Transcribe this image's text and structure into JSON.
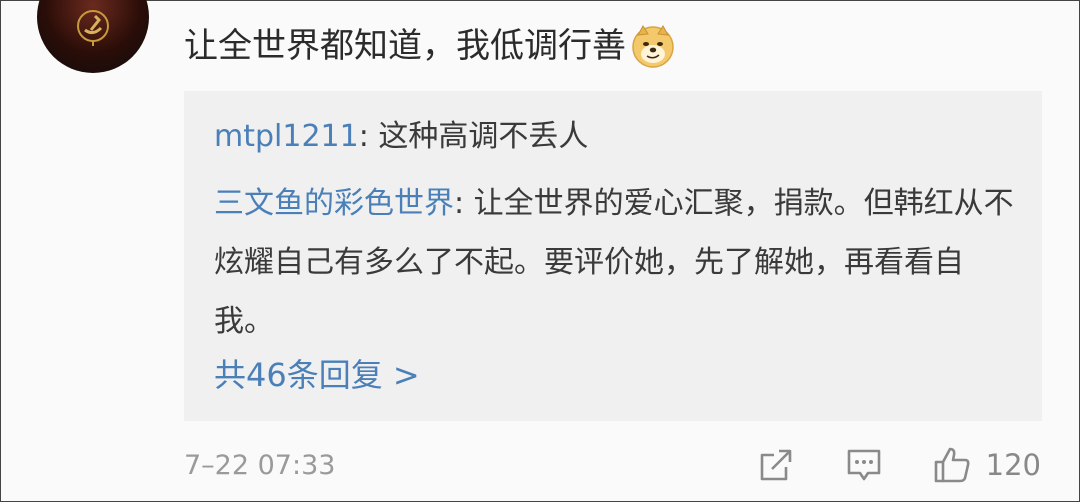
{
  "comment": {
    "avatar_icon": "profile-avatar-emblem-icon",
    "text": "让全世界都知道，我低调行善",
    "emoji_icon": "doge-emoji-icon"
  },
  "replies": [
    {
      "user": "mtpl1211",
      "sep": ": ",
      "text": "这种高调不丢人"
    },
    {
      "user": "三文鱼的彩色世界",
      "sep": ": ",
      "text": "让全世界的爱心汇聚，捐款。但韩红从不炫耀自己有多么了不起。要评价她，先了解她，再看看自我。"
    }
  ],
  "more_replies": {
    "label": "共46条回复 >"
  },
  "footer": {
    "timestamp": "7–22 07:33",
    "share_icon": "share-icon",
    "comment_icon": "comment-icon",
    "like_icon": "thumbs-up-icon",
    "like_count": "120"
  },
  "colors": {
    "link": "#4a7fb8",
    "text": "#2b2b2b",
    "muted": "#9a9a9a",
    "reply_bg": "#f0f0f0"
  }
}
